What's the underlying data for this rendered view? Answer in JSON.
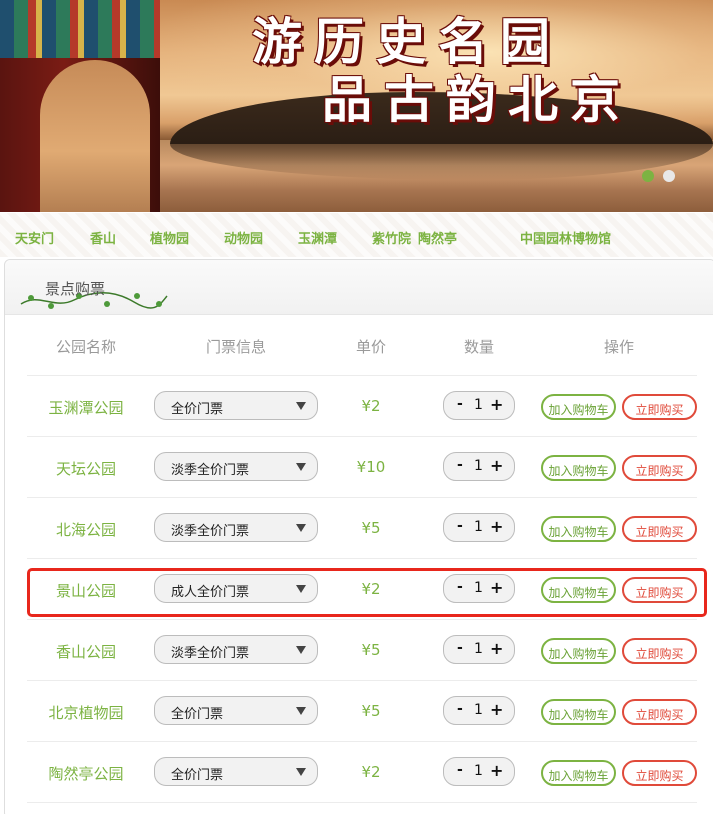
{
  "banner": {
    "title_line1": "游历史名园",
    "title_line2": "品古韵北京",
    "carousel_dots": 2
  },
  "nav": {
    "items": [
      "天安门",
      "香山",
      "植物园",
      "动物园",
      "玉渊潭",
      "紫竹院",
      "陶然亭",
      "中国园林博物馆"
    ]
  },
  "panel": {
    "title": "景点购票"
  },
  "table": {
    "headers": {
      "park": "公园名称",
      "ticket": "门票信息",
      "price": "单价",
      "quantity": "数量",
      "action": "操作"
    },
    "add_to_cart_label": "加入购物车",
    "buy_now_label": "立即购买",
    "minus": "-",
    "plus": "+",
    "rows": [
      {
        "park": "玉渊潭公园",
        "ticket": "全价门票",
        "price": "¥2",
        "qty": "1"
      },
      {
        "park": "天坛公园",
        "ticket": "淡季全价门票",
        "price": "¥10",
        "qty": "1"
      },
      {
        "park": "北海公园",
        "ticket": "淡季全价门票",
        "price": "¥5",
        "qty": "1"
      },
      {
        "park": "景山公园",
        "ticket": "成人全价门票",
        "price": "¥2",
        "qty": "1"
      },
      {
        "park": "香山公园",
        "ticket": "淡季全价门票",
        "price": "¥5",
        "qty": "1"
      },
      {
        "park": "北京植物园",
        "ticket": "全价门票",
        "price": "¥5",
        "qty": "1"
      },
      {
        "park": "陶然亭公园",
        "ticket": "全价门票",
        "price": "¥2",
        "qty": "1"
      }
    ]
  },
  "colors": {
    "accent_green": "#7cb342",
    "buy_red": "#e04a3a",
    "highlight_red": "#e8271c"
  }
}
